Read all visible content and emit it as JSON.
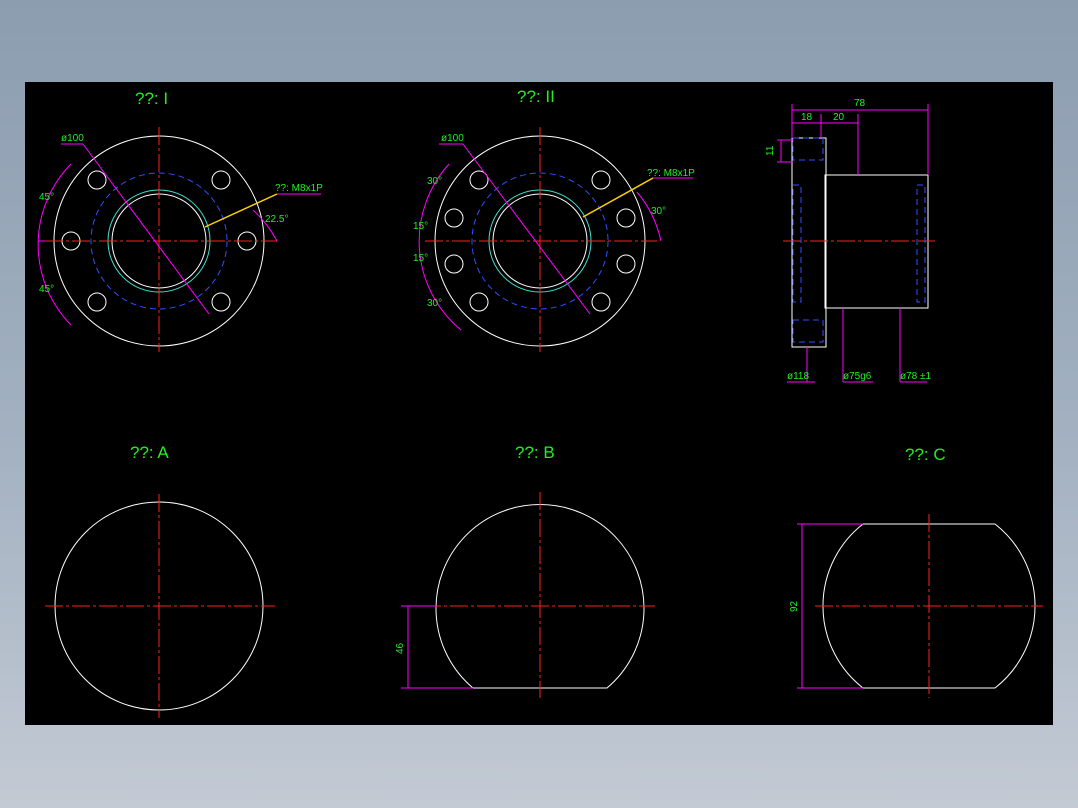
{
  "views": {
    "v1": {
      "title": "??: I",
      "dia": "ø100",
      "thread": "??: M8x1P",
      "ang_a": "45°",
      "ang_b": "45°",
      "ang_c": "22.5°"
    },
    "v2": {
      "title": "??: II",
      "dia": "ø100",
      "thread": "??: M8x1P",
      "ang_a": "30°",
      "ang_b": "15°",
      "ang_c": "15°",
      "ang_d": "30°",
      "ang_e": "30°"
    },
    "side": {
      "d_total": "78",
      "d_flange": "18",
      "d_step": "20",
      "d_h": "11",
      "dia1": "ø118",
      "dia2": "ø75g6",
      "dia3": "ø78 ±1"
    },
    "a": {
      "title": "??: A"
    },
    "b": {
      "title": "??: B",
      "dim": "46"
    },
    "c": {
      "title": "??: C",
      "dim": "92"
    }
  },
  "colors": {
    "background": "#000000",
    "outline": "#ffffff",
    "centerline": "#ff2020",
    "hidden": "#3050ff",
    "dimension": "#ff00ff",
    "text": "#22ee22"
  }
}
